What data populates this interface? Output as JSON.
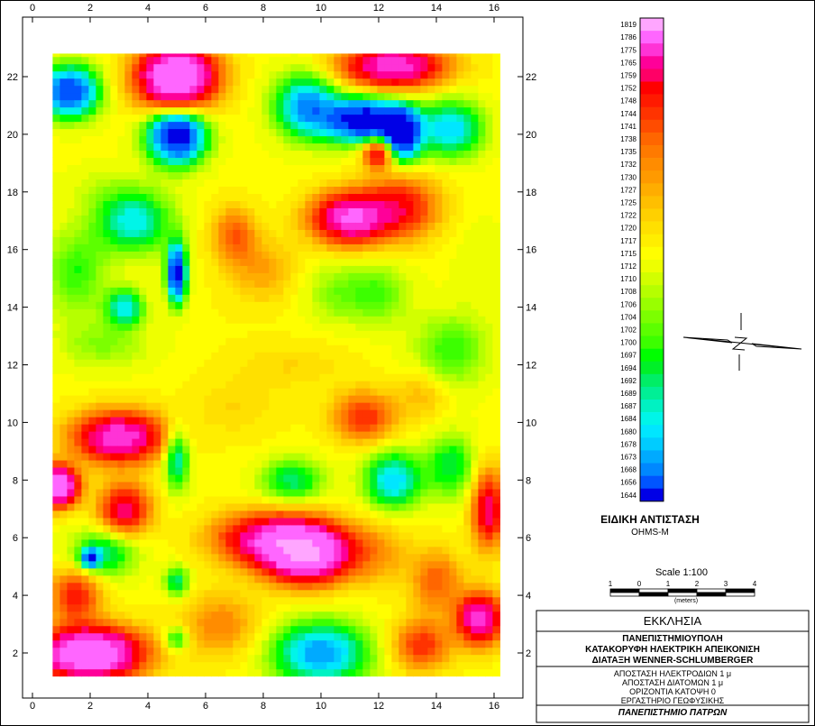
{
  "chart_data": {
    "type": "heatmap",
    "title": "",
    "xlabel": "",
    "ylabel": "",
    "xlim": [
      0,
      16.5
    ],
    "ylim": [
      0,
      23.3
    ],
    "data_extent_x": [
      0.7,
      16.2
    ],
    "data_extent_y": [
      1.2,
      22.8
    ],
    "x_ticks": [
      0,
      2,
      4,
      6,
      8,
      10,
      12,
      14,
      16
    ],
    "y_ticks": [
      2,
      4,
      6,
      8,
      10,
      12,
      14,
      16,
      18,
      20,
      22
    ],
    "colorbar": {
      "levels": [
        1819,
        1786,
        1775,
        1765,
        1759,
        1752,
        1748,
        1744,
        1741,
        1738,
        1735,
        1732,
        1730,
        1727,
        1725,
        1722,
        1720,
        1717,
        1715,
        1712,
        1710,
        1708,
        1706,
        1704,
        1702,
        1700,
        1697,
        1694,
        1692,
        1689,
        1687,
        1684,
        1680,
        1678,
        1673,
        1668,
        1656,
        1644
      ],
      "colors": [
        "#ffa6ff",
        "#ff66ff",
        "#ff33d6",
        "#ff0099",
        "#ff0066",
        "#ff0000",
        "#ff1a00",
        "#ff3300",
        "#ff4c00",
        "#ff6600",
        "#ff7a00",
        "#ff8c00",
        "#ff9a00",
        "#ffad00",
        "#ffbf00",
        "#ffd000",
        "#ffe000",
        "#ffee00",
        "#fffe00",
        "#eeff00",
        "#d2ff00",
        "#b6ff00",
        "#99ff00",
        "#7cff00",
        "#5cff00",
        "#3cff00",
        "#00ff00",
        "#00f028",
        "#00ee66",
        "#00ef96",
        "#00f2c2",
        "#00f5e8",
        "#00e6ff",
        "#00ccff",
        "#00aaff",
        "#0088ff",
        "#0055ff",
        "#0000e6"
      ]
    },
    "features": [
      {
        "x": 5.0,
        "y": 22.0,
        "v": 1819,
        "sx": 1.2,
        "sy": 1.0
      },
      {
        "x": 12.5,
        "y": 22.4,
        "v": 1786,
        "sx": 1.6,
        "sy": 0.7
      },
      {
        "x": 11.0,
        "y": 17.1,
        "v": 1786,
        "sx": 1.2,
        "sy": 0.8
      },
      {
        "x": 12.8,
        "y": 17.5,
        "v": 1752,
        "sx": 1.2,
        "sy": 1.0
      },
      {
        "x": 12.0,
        "y": 19.4,
        "v": 1765,
        "sx": 0.5,
        "sy": 0.5
      },
      {
        "x": 11.5,
        "y": 20.5,
        "v": 1644,
        "sx": 1.2,
        "sy": 0.7
      },
      {
        "x": 12.8,
        "y": 20.0,
        "v": 1644,
        "sx": 0.6,
        "sy": 0.8
      },
      {
        "x": 5.0,
        "y": 20.0,
        "v": 1644,
        "sx": 0.9,
        "sy": 0.9
      },
      {
        "x": 5.0,
        "y": 15.2,
        "v": 1644,
        "sx": 0.3,
        "sy": 0.9
      },
      {
        "x": 1.3,
        "y": 21.5,
        "v": 1656,
        "sx": 0.9,
        "sy": 0.8
      },
      {
        "x": 9.5,
        "y": 21.0,
        "v": 1673,
        "sx": 1.0,
        "sy": 1.0
      },
      {
        "x": 14.5,
        "y": 20.2,
        "v": 1680,
        "sx": 1.0,
        "sy": 0.9
      },
      {
        "x": 3.5,
        "y": 17.0,
        "v": 1684,
        "sx": 1.2,
        "sy": 1.0
      },
      {
        "x": 1.5,
        "y": 15.2,
        "v": 1700,
        "sx": 1.0,
        "sy": 1.4
      },
      {
        "x": 2.2,
        "y": 18.2,
        "v": 1712,
        "sx": 1.2,
        "sy": 0.7
      },
      {
        "x": 7.0,
        "y": 16.5,
        "v": 1741,
        "sx": 0.7,
        "sy": 0.9
      },
      {
        "x": 6.8,
        "y": 14.2,
        "v": 1717,
        "sx": 1.0,
        "sy": 1.0
      },
      {
        "x": 3.2,
        "y": 14.0,
        "v": 1684,
        "sx": 0.6,
        "sy": 0.6
      },
      {
        "x": 8.0,
        "y": 15.3,
        "v": 1730,
        "sx": 1.0,
        "sy": 1.0
      },
      {
        "x": 10.5,
        "y": 14.5,
        "v": 1706,
        "sx": 1.0,
        "sy": 1.0
      },
      {
        "x": 12.0,
        "y": 14.5,
        "v": 1702,
        "sx": 1.0,
        "sy": 1.0
      },
      {
        "x": 15.5,
        "y": 15.5,
        "v": 1712,
        "sx": 0.8,
        "sy": 1.5
      },
      {
        "x": 14.5,
        "y": 12.5,
        "v": 1700,
        "sx": 1.2,
        "sy": 1.2
      },
      {
        "x": 2.5,
        "y": 12.7,
        "v": 1706,
        "sx": 1.5,
        "sy": 0.8
      },
      {
        "x": 9.0,
        "y": 12.0,
        "v": 1722,
        "sx": 2.0,
        "sy": 0.8
      },
      {
        "x": 3.0,
        "y": 9.5,
        "v": 1786,
        "sx": 1.4,
        "sy": 0.8
      },
      {
        "x": 0.9,
        "y": 7.8,
        "v": 1819,
        "sx": 0.6,
        "sy": 0.6
      },
      {
        "x": 3.2,
        "y": 7.0,
        "v": 1765,
        "sx": 0.8,
        "sy": 0.8
      },
      {
        "x": 5.0,
        "y": 8.8,
        "v": 1684,
        "sx": 0.4,
        "sy": 1.0
      },
      {
        "x": 7.0,
        "y": 10.5,
        "v": 1722,
        "sx": 1.5,
        "sy": 1.0
      },
      {
        "x": 11.5,
        "y": 10.2,
        "v": 1748,
        "sx": 1.0,
        "sy": 0.8
      },
      {
        "x": 12.5,
        "y": 8.0,
        "v": 1680,
        "sx": 0.9,
        "sy": 0.9
      },
      {
        "x": 14.5,
        "y": 8.5,
        "v": 1694,
        "sx": 0.8,
        "sy": 1.0
      },
      {
        "x": 9.0,
        "y": 8.0,
        "v": 1692,
        "sx": 1.0,
        "sy": 0.7
      },
      {
        "x": 15.8,
        "y": 7.0,
        "v": 1765,
        "sx": 0.5,
        "sy": 1.2
      },
      {
        "x": 9.5,
        "y": 5.5,
        "v": 1819,
        "sx": 1.4,
        "sy": 0.9
      },
      {
        "x": 8.0,
        "y": 6.0,
        "v": 1765,
        "sx": 1.6,
        "sy": 0.8
      },
      {
        "x": 12.0,
        "y": 5.5,
        "v": 1730,
        "sx": 1.0,
        "sy": 1.0
      },
      {
        "x": 2.5,
        "y": 5.5,
        "v": 1692,
        "sx": 1.0,
        "sy": 0.8
      },
      {
        "x": 2.0,
        "y": 5.3,
        "v": 1668,
        "sx": 0.3,
        "sy": 0.3
      },
      {
        "x": 5.0,
        "y": 4.5,
        "v": 1692,
        "sx": 0.4,
        "sy": 0.5
      },
      {
        "x": 1.5,
        "y": 4.0,
        "v": 1752,
        "sx": 0.8,
        "sy": 0.8
      },
      {
        "x": 2.0,
        "y": 2.0,
        "v": 1819,
        "sx": 1.6,
        "sy": 0.8
      },
      {
        "x": 5.0,
        "y": 2.5,
        "v": 1692,
        "sx": 0.4,
        "sy": 0.4
      },
      {
        "x": 10.0,
        "y": 2.0,
        "v": 1673,
        "sx": 1.5,
        "sy": 1.0
      },
      {
        "x": 14.0,
        "y": 4.5,
        "v": 1741,
        "sx": 0.8,
        "sy": 1.0
      },
      {
        "x": 15.5,
        "y": 3.2,
        "v": 1786,
        "sx": 0.7,
        "sy": 0.8
      },
      {
        "x": 13.5,
        "y": 2.3,
        "v": 1748,
        "sx": 0.9,
        "sy": 0.8
      },
      {
        "x": 6.5,
        "y": 3.0,
        "v": 1735,
        "sx": 1.2,
        "sy": 1.0
      },
      {
        "x": 13.5,
        "y": 11.0,
        "v": 1727,
        "sx": 0.8,
        "sy": 0.8
      }
    ]
  },
  "colorbar_text": {
    "title": "ΕΙΔΙΚΗ ΑΝΤΙΣΤΑΣΗ",
    "units": "OHMS-M"
  },
  "scale": {
    "title": "Scale 1:100",
    "ticks": [
      "1",
      "0",
      "1",
      "2",
      "3",
      "4"
    ],
    "unit": "(meters)"
  },
  "title_block": {
    "site": "ΕΚΚΛΗΣΙΑ",
    "line1": "ΠΑΝΕΠΙΣΤΗΜΙΟΥΠΟΛΗ",
    "line2": "ΚΑΤΑΚΟΡΥΦΗ ΗΛΕΚΤΡΙΚΗ ΑΠΕΙΚΟΝΙΣΗ",
    "line3": "ΔΙΑΤΑΞΗ WENNER-SCHLUMBERGER",
    "param1": "ΑΠΟΣΤΑΣΗ ΗΛΕΚΤΡΟΔΙΩΝ 1 μ",
    "param2": "ΑΠΟΣΤΑΣΗ ΔΙΑΤΟΜΩΝ 1 μ",
    "param3": "ΟΡΙΖΟΝΤΙΑ ΚΑΤΟΨΗ 0",
    "param4": "ΕΡΓΑΣΤΗΡΙΟ ΓΕΩΦΥΣΙΚΗΣ",
    "institution": "ΠΑΝΕΠΙΣΤΗΜΙΟ ΠΑΤΡΩΝ"
  }
}
